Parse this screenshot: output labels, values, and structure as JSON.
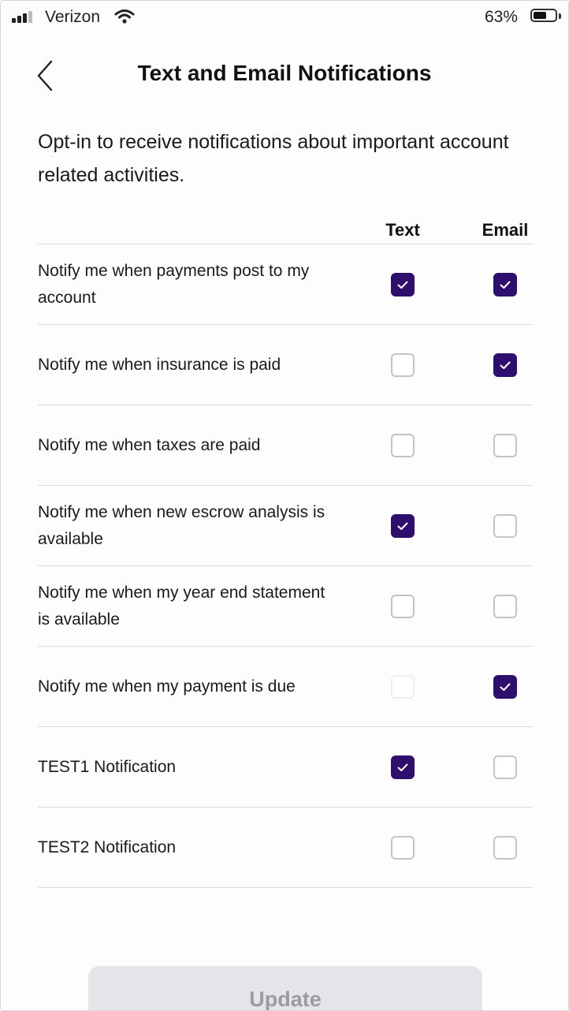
{
  "status_bar": {
    "carrier": "Verizon",
    "battery_percent": "63%",
    "battery_level": 0.63,
    "icons": [
      "signal-icon",
      "wifi-icon",
      "battery-icon"
    ]
  },
  "header": {
    "title": "Text and Email Notifications",
    "back_icon": "chevron-left-icon"
  },
  "intro": "Opt-in to receive notifications about important account related activities.",
  "columns": {
    "text": "Text",
    "email": "Email"
  },
  "rows": [
    {
      "label": "Notify me when payments post to my account",
      "text": true,
      "email": true
    },
    {
      "label": "Notify me when insurance is paid",
      "text": false,
      "email": true
    },
    {
      "label": "Notify me when taxes are paid",
      "text": false,
      "email": false
    },
    {
      "label": "Notify me when new escrow analysis is available",
      "text": true,
      "email": false
    },
    {
      "label": "Notify me when my year end statement is available",
      "text": false,
      "email": false
    },
    {
      "label": "Notify me when my payment is due",
      "text": false,
      "text_disabled": true,
      "email": true
    },
    {
      "label": "TEST1 Notification",
      "text": true,
      "email": false
    },
    {
      "label": "TEST2 Notification",
      "text": false,
      "email": false
    }
  ],
  "update_button": {
    "label": "Update",
    "enabled": false
  },
  "colors": {
    "checked": "#2e0f6e",
    "unchecked_border": "#c4c4c4",
    "button_bg": "#e4e5e8",
    "button_text": "#9a9ca2"
  }
}
